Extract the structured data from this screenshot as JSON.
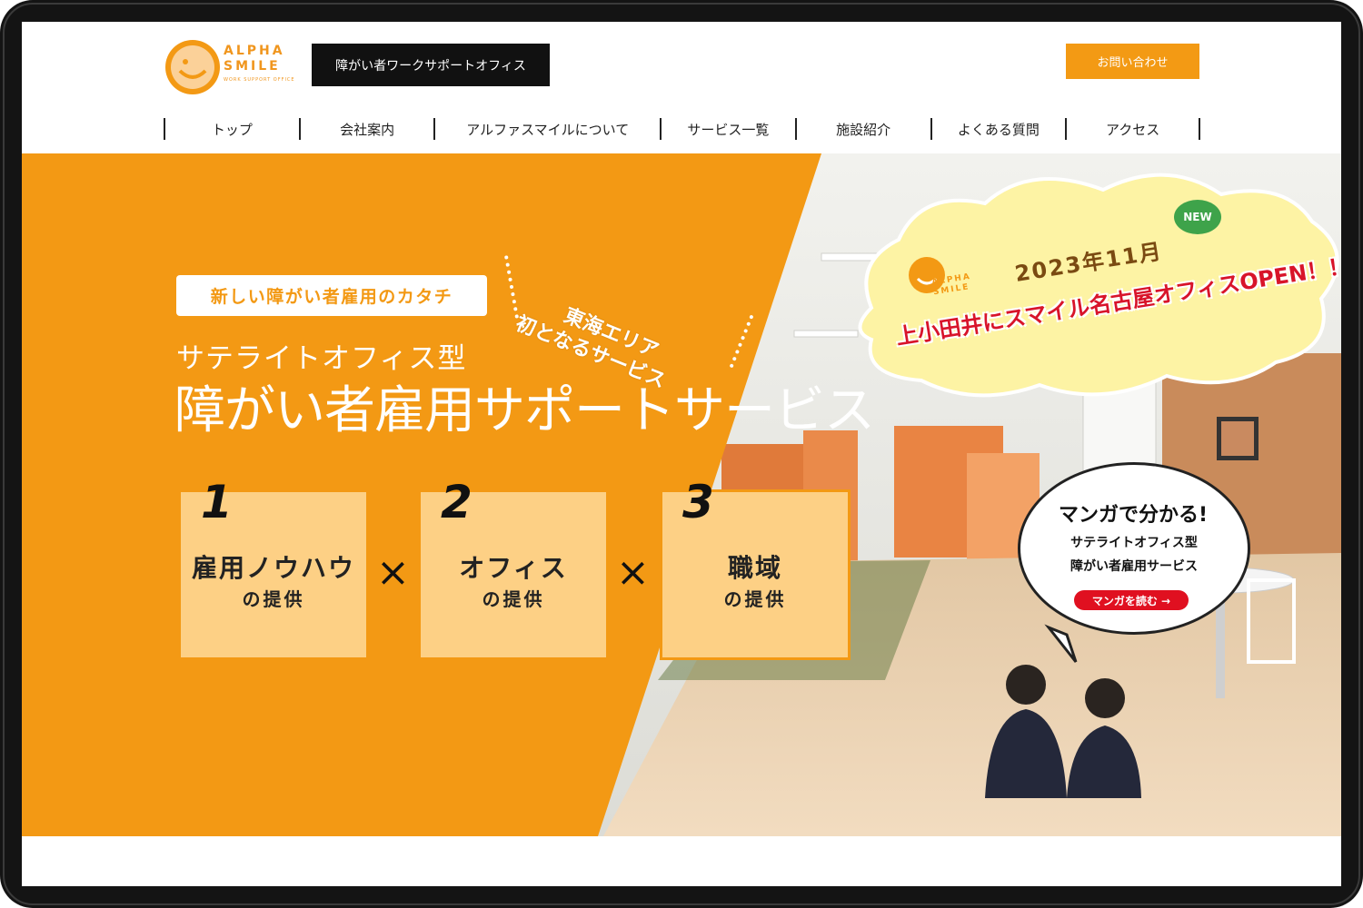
{
  "brand": {
    "logo_line1": "ALPHA",
    "logo_line2": "SMILE",
    "logo_sub": "WORK SUPPORT OFFICE",
    "tagline": "障がい者ワークサポートオフィス",
    "accent_color": "#f39914"
  },
  "header": {
    "contact_label": "お問い合わせ"
  },
  "nav": {
    "items": [
      {
        "label": "トップ"
      },
      {
        "label": "会社案内"
      },
      {
        "label": "アルファスマイルについて"
      },
      {
        "label": "サービス一覧"
      },
      {
        "label": "施設紹介"
      },
      {
        "label": "よくある質問"
      },
      {
        "label": "アクセス"
      }
    ]
  },
  "hero": {
    "chip": "新しい障がい者雇用のカタチ",
    "badge_line1": "東海エリア",
    "badge_line2": "初となるサービス",
    "subtitle": "サテライトオフィス型",
    "title": "障がい者雇用サポートサービス",
    "cards": [
      {
        "num": "1",
        "title": "雇用ノウハウ",
        "sub": "の提供"
      },
      {
        "num": "2",
        "title": "オフィス",
        "sub": "の提供"
      },
      {
        "num": "3",
        "title": "職域",
        "sub": "の提供"
      }
    ],
    "times": "×"
  },
  "announcement": {
    "logo_line1": "ALPHA",
    "logo_line2": "SMILE",
    "date": "2023年11月",
    "new_badge": "NEW",
    "headline": "上小田井にスマイル名古屋オフィスOPEN！！"
  },
  "manga": {
    "title": "マンガで分かる!",
    "line1": "サテライトオフィス型",
    "line2": "障がい者雇用サービス",
    "button": "マンガを読む →"
  }
}
